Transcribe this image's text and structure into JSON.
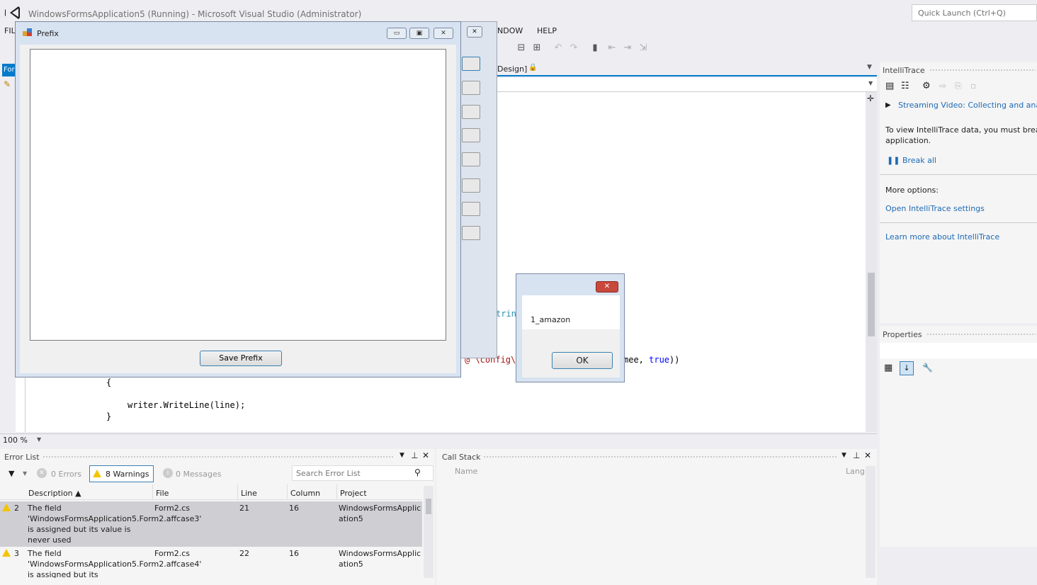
{
  "window": {
    "title": "WindowsFormsApplication5 (Running) - Microsoft Visual Studio (Administrator)",
    "quick_launch_placeholder": "Quick Launch (Ctrl+Q)"
  },
  "menu": [
    "FIL",
    "NDOW",
    "HELP"
  ],
  "left_tab_label": "For",
  "editor": {
    "tab_label": "Design]",
    "code_lines": {
      "frag_string": "trin",
      "frag_config": "@ \\config\\",
      "frag_args_pre": "mee, ",
      "frag_true": "true",
      "frag_args_post": "))",
      "brace_open": "{",
      "write_call": "writer.WriteLine(line);",
      "brace_close": "}"
    },
    "zoom": "100 %"
  },
  "prefix_window": {
    "title": "Prefix",
    "textbox_value": "",
    "save_button": "Save Prefix"
  },
  "message_box": {
    "text": "1_amazon",
    "ok": "OK"
  },
  "intellitrace": {
    "title": "IntelliTrace",
    "streaming_link": "Streaming Video: Collecting and anal",
    "info": "To view IntelliTrace data, you must break",
    "info2": "application.",
    "break_all": "Break all",
    "more_options": "More options:",
    "open_settings": "Open IntelliTrace settings",
    "learn_more": "Learn more about IntelliTrace"
  },
  "properties": {
    "title": "Properties"
  },
  "error_list": {
    "title": "Error List",
    "errors": "0 Errors",
    "warnings": "8 Warnings",
    "messages": "0 Messages",
    "search_placeholder": "Search Error List",
    "columns": [
      "Description",
      "File",
      "Line",
      "Column",
      "Project"
    ],
    "rows": [
      {
        "num": "2",
        "desc": "The field 'WindowsFormsApplication5.Form2.affcase3' is assigned but its value is never used",
        "file": "Form2.cs",
        "line": "21",
        "column": "16",
        "project": "WindowsFormsApplication5"
      },
      {
        "num": "3",
        "desc": "The field 'WindowsFormsApplication5.Form2.affcase4' is assigned but its",
        "file": "Form2.cs",
        "line": "22",
        "column": "16",
        "project": "WindowsFormsApplication5"
      }
    ]
  },
  "call_stack": {
    "title": "Call Stack",
    "col_name": "Name",
    "col_lang": "Lang"
  },
  "colors": {
    "accent": "#007acc",
    "warning": "#f4c400",
    "close_red": "#c9483d"
  }
}
